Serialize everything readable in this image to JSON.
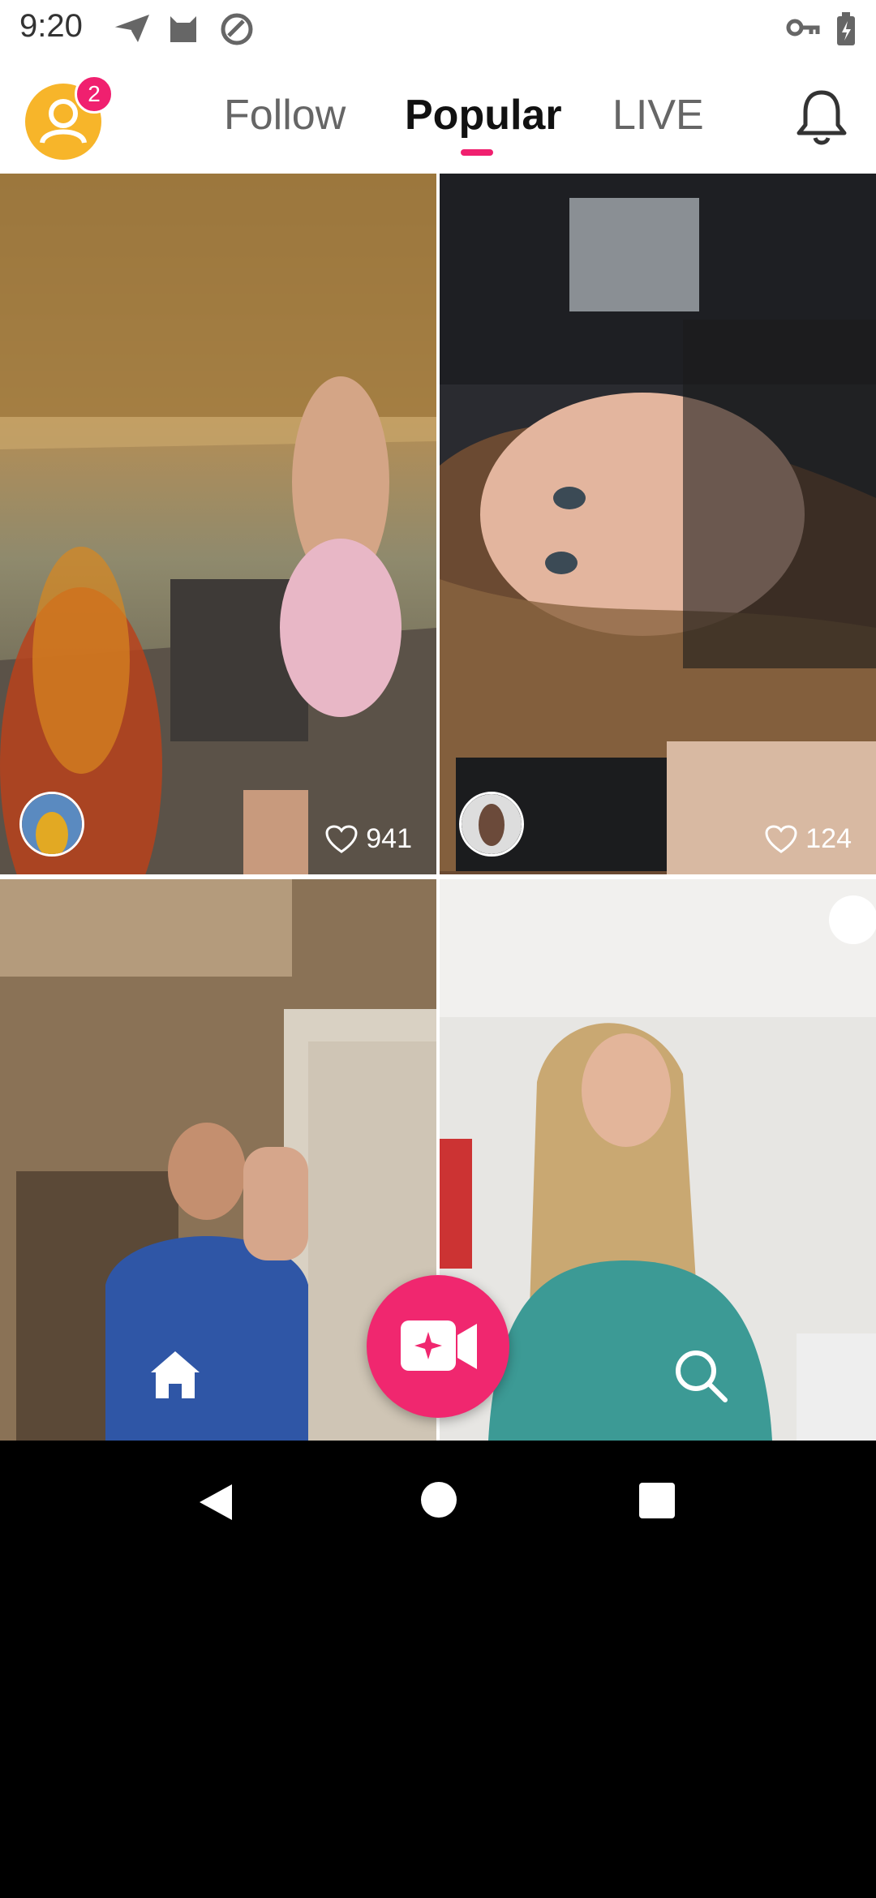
{
  "status_bar": {
    "time": "9:20",
    "icons": [
      "send-icon",
      "cat-icon",
      "data-saver-icon",
      "vpn-key-icon",
      "battery-charging-icon"
    ]
  },
  "header": {
    "profile_badge": "2",
    "tabs": [
      {
        "label": "Follow",
        "active": false
      },
      {
        "label": "Popular",
        "active": true
      },
      {
        "label": "LIVE",
        "active": false
      }
    ],
    "accent": "#f0206f"
  },
  "feed": {
    "items": [
      {
        "likes": "941"
      },
      {
        "likes": "124"
      },
      {
        "likes": ""
      },
      {
        "likes": ""
      }
    ]
  },
  "bottom_nav": {
    "items": [
      "home-icon",
      "record-video-icon",
      "search-icon"
    ],
    "record_color": "#f0276f"
  },
  "system_nav": [
    "back-icon",
    "home-circle-icon",
    "recents-icon"
  ]
}
